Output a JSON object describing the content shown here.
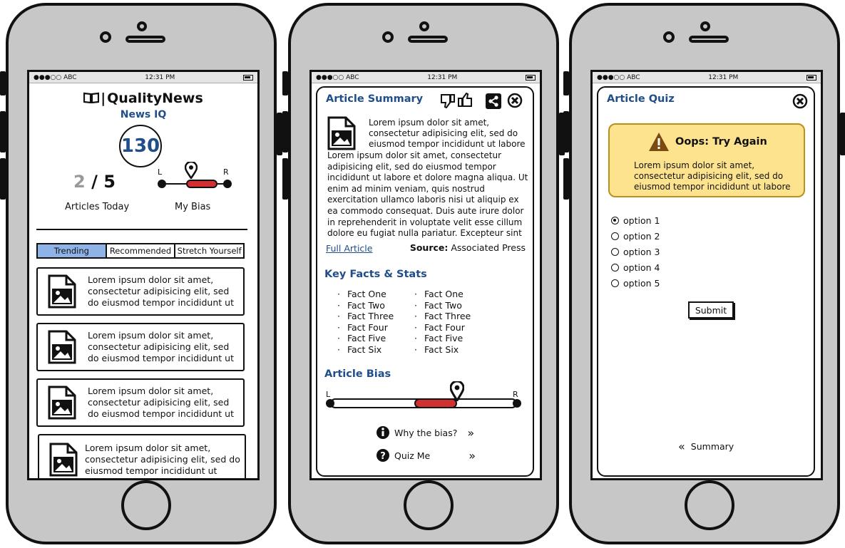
{
  "status_bar": {
    "carrier": "●●●○○ ABC",
    "time": "12:31 PM"
  },
  "screen1": {
    "logo": "QualityNews",
    "subtitle": "News IQ",
    "iq_score": "130",
    "articles_count": "2",
    "articles_total": "5",
    "articles_label": "Articles Today",
    "bias_label": "My Bias",
    "bias_left": "L",
    "bias_right": "R",
    "my_bias_value": 0.45,
    "tabs": [
      "Trending",
      "Recommended",
      "Stretch Yourself"
    ],
    "article_snippet": "Lorem ipsum dolor sit amet, consectetur adipisicing elit, sed do eiusmod tempor incididunt ut"
  },
  "screen2": {
    "title": "Article Summary",
    "intro": "Lorem ipsum dolor sit amet, consectetur adipisicing elit, sed do eiusmod tempor incididunt ut labore",
    "body": "Lorem ipsum dolor sit amet, consectetur adipisicing elit, sed do eiusmod tempor incididunt ut labore et dolore magna aliqua. Ut enim ad minim veniam, quis nostrud exercitation ullamco laboris nisi ut aliquip ex ea commodo consequat. Duis aute irure dolor in reprehenderit in voluptate velit esse cillum dolore eu fugiat nulla pariatur. Excepteur sint",
    "full_article": "Full Article",
    "source_label": "Source:",
    "source_value": "Associated Press",
    "facts_title": "Key Facts & Stats",
    "facts_col1": [
      "Fact One",
      "Fact Two",
      "Fact Three",
      "Fact Four",
      "Fact Five",
      "Fact Six"
    ],
    "facts_col2": [
      "Fact One",
      "Fact Two",
      "Fact Three",
      "Fact Four",
      "Fact Five",
      "Fact Six"
    ],
    "bias_title": "Article Bias",
    "bias_left": "L",
    "bias_right": "R",
    "article_bias_value": 0.68,
    "why_bias": "Why the bias?",
    "quiz_me": "Quiz Me"
  },
  "screen3": {
    "title": "Article Quiz",
    "alert_title": "Oops: Try Again",
    "alert_body": "Lorem ipsum dolor sit amet, consectetur adipisicing elit, sed do eiusmod tempor incididunt ut labore",
    "options": [
      "option 1",
      "option 2",
      "option 3",
      "option 4",
      "option 5"
    ],
    "selected_option": 0,
    "submit": "Submit",
    "back_summary": "Summary"
  },
  "colors": {
    "accent_blue": "#1f4e8a",
    "tab_active": "#8fb3e6",
    "alert_bg": "#fde38e",
    "bias_red": "#d03030"
  }
}
